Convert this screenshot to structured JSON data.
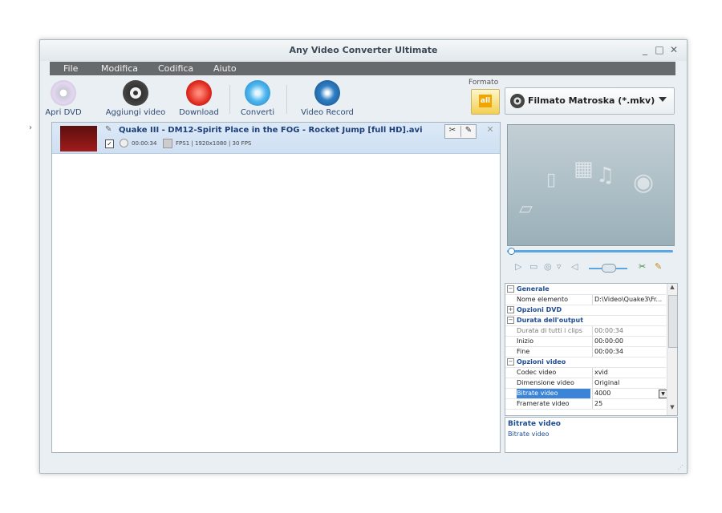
{
  "window": {
    "title": "Any Video Converter Ultimate",
    "controls": {
      "minimize": "_",
      "maximize": "□",
      "close": "✕"
    }
  },
  "menu": [
    "File",
    "Modifica",
    "Codifica",
    "Aiuto"
  ],
  "toolbar": {
    "open_dvd": "Apri DVD",
    "add_video": "Aggiungi video",
    "download": "Download",
    "convert": "Converti",
    "video_record": "Video Record"
  },
  "format": {
    "label": "Formato",
    "icon_text": "all",
    "selected": "Filmato Matroska (*.mkv)"
  },
  "file": {
    "title": "Quake III - DM12-Spirit Place in the FOG - Rocket Jump [full HD].avi",
    "duration": "00:00:34",
    "info": "FPS1 | 1920x1080 | 30 FPS",
    "checked": "✓"
  },
  "properties": [
    {
      "type": "cat",
      "expand": "−",
      "label": "Generale"
    },
    {
      "type": "row",
      "key": "Nome elemento",
      "value": "D:\\Video\\Quake3\\Fr..."
    },
    {
      "type": "cat",
      "expand": "+",
      "label": "Opzioni DVD"
    },
    {
      "type": "cat",
      "expand": "−",
      "label": "Durata dell'output"
    },
    {
      "type": "row",
      "key": "Durata di tutti i clips",
      "value": "00:00:34",
      "disabled": true
    },
    {
      "type": "row",
      "key": "Inizio",
      "value": "00:00:00"
    },
    {
      "type": "row",
      "key": "Fine",
      "value": "00:00:34"
    },
    {
      "type": "cat",
      "expand": "−",
      "label": "Opzioni video"
    },
    {
      "type": "row",
      "key": "Codec video",
      "value": "xvid"
    },
    {
      "type": "row",
      "key": "Dimensione video",
      "value": "Original"
    },
    {
      "type": "row",
      "key": "Bitrate video",
      "value": "4000",
      "selected": true
    },
    {
      "type": "row",
      "key": "Framerate video",
      "value": "25"
    }
  ],
  "description": {
    "title": "Bitrate video",
    "text": "Bitrate video"
  },
  "colors": {
    "accent": "#3b84d8",
    "menubar": "#676a6c",
    "row_highlight": "#dce9f7"
  }
}
